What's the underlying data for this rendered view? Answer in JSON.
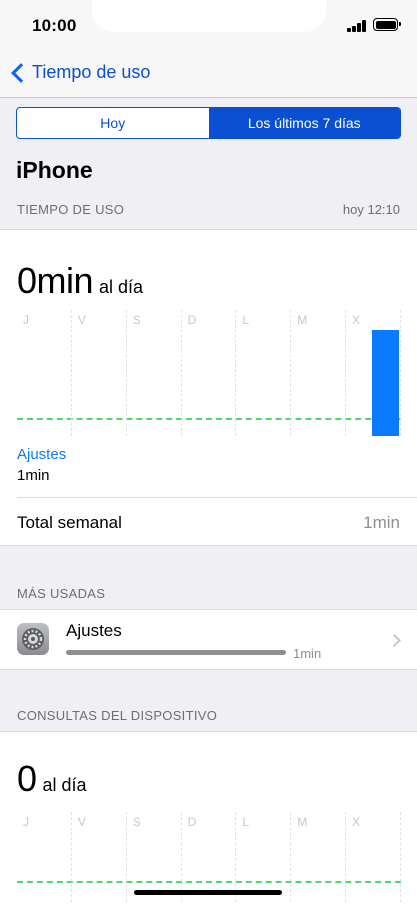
{
  "status": {
    "time": "10:00"
  },
  "nav": {
    "back_label": "Tiempo de uso"
  },
  "segments": {
    "today": "Hoy",
    "last7": "Los últimos 7 días",
    "selected": "last7"
  },
  "device": {
    "title": "iPhone"
  },
  "usage_section": {
    "header": "TIEMPO DE USO",
    "updated": "hoy 12:10"
  },
  "usage": {
    "average_value": "0min",
    "average_unit": "al día",
    "days": [
      "J",
      "V",
      "S",
      "D",
      "L",
      "M",
      "X"
    ],
    "legend_name": "Ajustes",
    "legend_value": "1min",
    "weekly_total_label": "Total semanal",
    "weekly_total_value": "1min"
  },
  "chart_data": {
    "type": "bar",
    "categories": [
      "J",
      "V",
      "S",
      "D",
      "L",
      "M",
      "X"
    ],
    "values": [
      0,
      0,
      0,
      0,
      0,
      0,
      1
    ],
    "ylim": [
      0,
      1
    ]
  },
  "most_used": {
    "header": "MÁS USADAS",
    "items": [
      {
        "name": "Ajustes",
        "time": "1min",
        "fraction": 1.0,
        "icon": "settings-gear-icon"
      }
    ]
  },
  "pickups_section": {
    "header": "CONSULTAS DEL DISPOSITIVO",
    "average_value": "0",
    "average_unit": "al día",
    "days": [
      "J",
      "V",
      "S",
      "D",
      "L",
      "M",
      "X"
    ]
  },
  "colors": {
    "accent": "#0a4fd1",
    "bar": "#0a7aff",
    "average_line": "#4cd964"
  }
}
